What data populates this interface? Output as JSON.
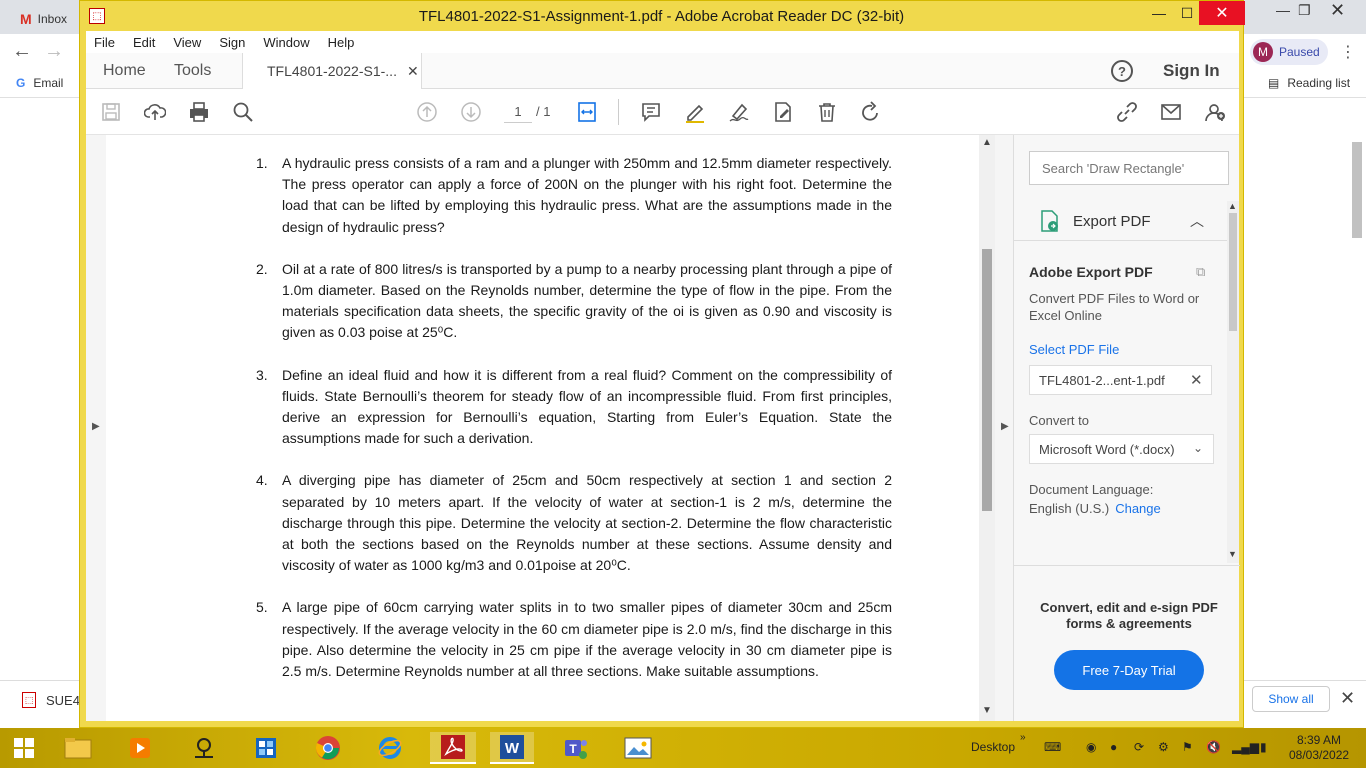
{
  "browser": {
    "tab_title": "Inbox",
    "profile_initial": "M",
    "profile_status": "Paused",
    "bookmark_email": "Email",
    "reading_list": "Reading list",
    "download_item": "SUE4",
    "show_all": "Show all"
  },
  "acrobat": {
    "window_title": "TFL4801-2022-S1-Assignment-1.pdf - Adobe Acrobat Reader DC (32-bit)",
    "menu": [
      "File",
      "Edit",
      "View",
      "Sign",
      "Window",
      "Help"
    ],
    "tabs": {
      "home": "Home",
      "tools": "Tools",
      "document": "TFL4801-2022-S1-..."
    },
    "sign_in": "Sign In",
    "page_current": "1",
    "page_total": "/ 1",
    "questions": [
      {
        "num": "1.",
        "text": "A hydraulic press consists of a ram and a plunger with 250mm and 12.5mm diameter respectively. The press operator can apply a force of 200N on the plunger with his right foot. Determine the load that can be lifted by employing this hydraulic press. What are the assumptions made in the design of hydraulic press?"
      },
      {
        "num": "2.",
        "text": "Oil at a rate of 800 litres/s is transported by a pump to a nearby processing plant through a pipe of 1.0m diameter. Based on the Reynolds number, determine the type of flow in the pipe. From the materials specification data sheets, the specific gravity of the oi is given as 0.90 and viscosity is given as 0.03 poise at 25⁰C."
      },
      {
        "num": "3.",
        "text": "Define an ideal fluid and how it is different from a real fluid? Comment on the compressibility of fluids. State Bernoulli’s theorem for steady flow of an incompressible fluid. From first principles, derive an expression for Bernoulli’s equation, Starting from Euler’s Equation. State the assumptions made for such a derivation."
      },
      {
        "num": "4.",
        "text": "A diverging pipe has diameter of 25cm and 50cm respectively at section 1 and section 2 separated by 10 meters apart. If the velocity of water at section-1 is 2 m/s, determine the discharge through this pipe. Determine the velocity at section-2. Determine the flow characteristic at both the sections based on the Reynolds number at these sections. Assume density and viscosity of water as 1000 kg/m3 and 0.01poise at 20⁰C."
      },
      {
        "num": "5.",
        "text": "A large pipe of 60cm carrying water splits in to two smaller pipes of diameter 30cm and 25cm respectively. If the average velocity in the 60 cm diameter pipe is 2.0 m/s, find the discharge in this pipe. Also determine the velocity in 25 cm pipe if the average velocity in 30 cm diameter pipe is 2.5 m/s. Determine Reynolds number at all three sections. Make suitable assumptions."
      }
    ],
    "right_pane": {
      "search_placeholder": "Search 'Draw Rectangle'",
      "export_title": "Export PDF",
      "section_title": "Adobe Export PDF",
      "description": "Convert PDF Files to Word or Excel Online",
      "select_file": "Select PDF File",
      "file_name": "TFL4801-2...ent-1.pdf",
      "convert_to": "Convert to",
      "format": "Microsoft Word (*.docx)",
      "doc_language_label": "Document Language:",
      "doc_language_value": "English (U.S.)",
      "change": "Change",
      "promo": "Convert, edit and e-sign PDF forms & agreements",
      "trial_button": "Free 7-Day Trial"
    }
  },
  "taskbar": {
    "desktop_label": "Desktop",
    "time": "8:39 AM",
    "date": "08/03/2022"
  }
}
